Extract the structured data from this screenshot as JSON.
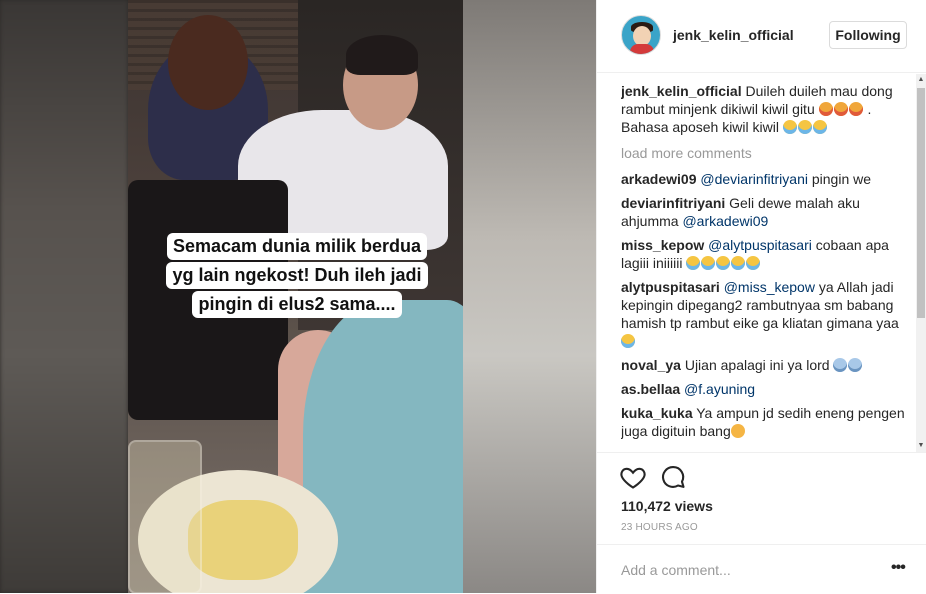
{
  "post": {
    "username": "jenk_kelin_official",
    "follow_label": "Following",
    "video_caption_lines": [
      "Semacam dunia milik berdua",
      "yg lain ngekost! Duh ileh jadi",
      "pingin di elus2 sama...."
    ]
  },
  "caption": {
    "username": "jenk_kelin_official",
    "text_a": "Duileh duileh mau dong rambut minjenk dikiwil kiwil gitu",
    "text_b": " . Bahasa aposeh kiwil kiwil"
  },
  "load_more_label": "load more comments",
  "comments": [
    {
      "user": "arkadewi09",
      "mention": "@deviarinfitriyani",
      "text": " pingin we"
    },
    {
      "user": "deviarinfitriyani",
      "text_before": "Geli dewe malah aku ahjumma ",
      "mention": "@arkadewi09"
    },
    {
      "user": "miss_kepow",
      "mention": "@alytpuspitasari",
      "text": " cobaan apa lagiii iniiiiii"
    },
    {
      "user": "alytpuspitasari",
      "mention": "@miss_kepow",
      "text": " ya Allah jadi kepingin dipegang2 rambutnyaa sm babang hamish tp rambut eike ga kliatan gimana yaa"
    },
    {
      "user": "noval_ya",
      "text": "Ujian apalagi ini ya lord"
    },
    {
      "user": "as.bellaa",
      "mention": "@f.ayuning"
    },
    {
      "user": "kuka_kuka",
      "text": "Ya ampun jd sedih eneng pengen juga digituin bang"
    }
  ],
  "stats": {
    "views": "110,472 views",
    "time_ago": "23 HOURS AGO"
  },
  "add_comment_placeholder": "Add a comment...",
  "icons": {
    "like": "heart-icon",
    "comment": "comment-bubble-icon",
    "more": "more-options-icon"
  },
  "colors": {
    "mention": "#003569",
    "muted": "#999999",
    "text": "#262626",
    "border": "#efefef"
  }
}
